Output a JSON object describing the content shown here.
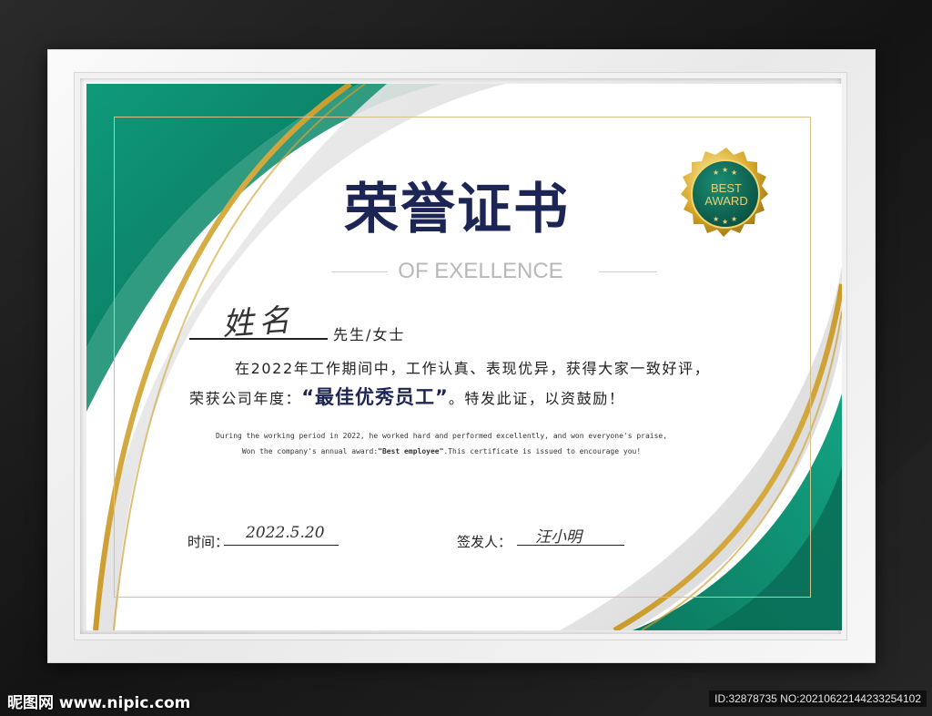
{
  "certificate": {
    "title": "荣誉证书",
    "subtitle": "OF EXELLENCE",
    "badge_line1": "BEST",
    "badge_line2": "AWARD",
    "name_handwritten": "姓名",
    "salutation": "先生/女士",
    "body_line1": "在2022年工作期间中，工作认真、表现优异，获得大家一致好评，",
    "body_line2_prefix": "荣获公司年度：",
    "award": "“最佳优秀员工”",
    "body_line2_suffix": "。特发此证，以资鼓励！",
    "english_line1": "During the working period in 2022, he worked hard and performed excellently, and won everyone's praise,",
    "english_line2_prefix": "Won the company's annual award:",
    "english_award": "\"Best employee\"",
    "english_line2_suffix": ".This certificate is issued to encourage you!",
    "time_label": "时间：",
    "date_handwritten": "2022.5.20",
    "issuer_label": "签发人：",
    "issuer_handwritten": "汪小明"
  },
  "watermark": {
    "site": "昵图网 www.nipic.com",
    "id_text": "ID:32878735 NO:20210622144233254102"
  },
  "colors": {
    "green": "#0f9a7a",
    "dark_green": "#0a6f58",
    "gold": "#d9b43f",
    "navy": "#1d2554",
    "background": "#1b1b1b"
  }
}
